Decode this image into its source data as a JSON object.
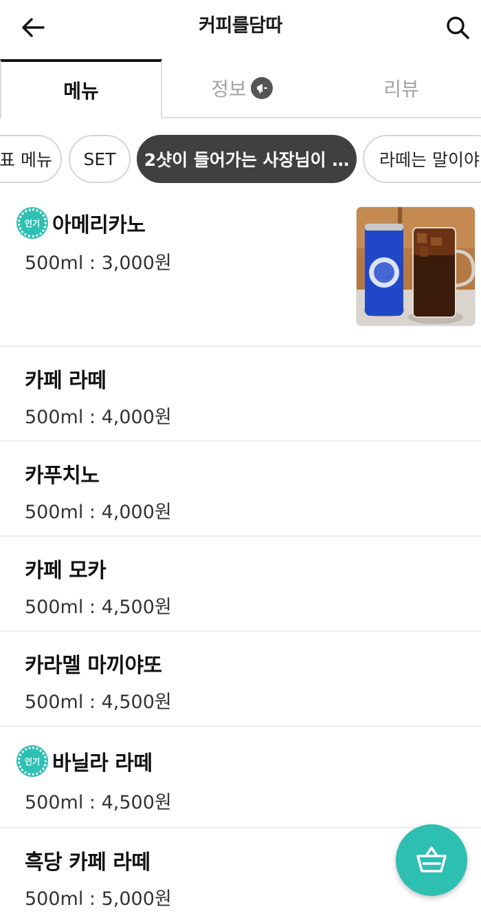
{
  "header": {
    "title": "커피를담따"
  },
  "tabs": [
    {
      "label": "메뉴"
    },
    {
      "label": "정보"
    },
    {
      "label": "리뷰"
    }
  ],
  "chips": [
    {
      "label": "대표 메뉴"
    },
    {
      "label": "SET"
    },
    {
      "label": "2샷이 들어가는 사장님이 …"
    },
    {
      "label": "라떼는 말이야"
    }
  ],
  "badge_label": "인기",
  "menu": [
    {
      "name": "아메리카노",
      "price": "500ml : 3,000원",
      "popular": true
    },
    {
      "name": "카페 라떼",
      "price": "500ml : 4,000원",
      "popular": false
    },
    {
      "name": "카푸치노",
      "price": "500ml : 4,000원",
      "popular": false
    },
    {
      "name": "카페 모카",
      "price": "500ml : 4,500원",
      "popular": false
    },
    {
      "name": "카라멜 마끼야또",
      "price": "500ml : 4,500원",
      "popular": false
    },
    {
      "name": "바닐라 라떼",
      "price": "500ml : 4,500원",
      "popular": true
    },
    {
      "name": "흑당 카페 라떼",
      "price": "500ml : 5,000원",
      "popular": false
    }
  ],
  "colors": {
    "accent": "#2dbfb2",
    "active_chip": "#404040"
  }
}
